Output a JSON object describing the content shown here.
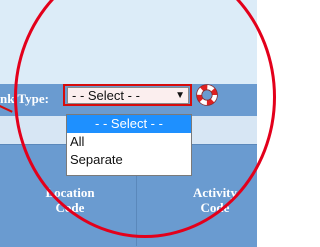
{
  "filter": {
    "label": "nk Type:",
    "select_value": "- - Select - -",
    "options": [
      "- - Select - -",
      "All",
      "Separate"
    ]
  },
  "table": {
    "columns": [
      {
        "line1": "Location",
        "line2": "Code"
      },
      {
        "line1": "Activity",
        "line2": "Code"
      }
    ]
  },
  "icons": {
    "dropdown_arrow": "chevron-down-icon",
    "help": "help-lifebuoy-icon"
  },
  "colors": {
    "header_blue": "#6a9bd0",
    "highlight_red": "#e3001b",
    "selected_option": "#1e90ff"
  }
}
